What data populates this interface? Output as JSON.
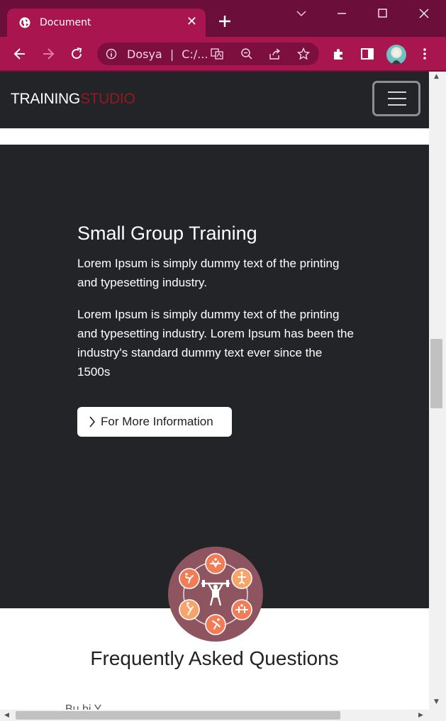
{
  "browser": {
    "tab_title": "Document",
    "tab_close": "✕",
    "new_tab": "+",
    "address_scheme": "Dosya",
    "address_separator": "|",
    "address_path": "C:/...",
    "colors": {
      "frame": "#6b0f3a",
      "tab": "#a8154f",
      "omnibox": "#7d0f3e"
    }
  },
  "navbar": {
    "brand_primary": "TRAINING",
    "brand_accent": "STUDIO",
    "brand_accent_color": "#8f1a22",
    "menu_icon": "hamburger-icon"
  },
  "hero": {
    "title": "Small Group Training",
    "paragraph_1": "Lorem Ipsum is simply dummy text of the printing and typesetting industry.",
    "paragraph_2": "Lorem Ipsum is simply dummy text of the printing and typesetting industry. Lorem Ipsum has been the industry's standard dummy text ever since the 1500s",
    "button_label": "For More Information",
    "button_icon": "chevron-right-icon",
    "background": "#232427"
  },
  "faq": {
    "title": "Frequently Asked Questions",
    "cut_off_text": "Bu bi Y ..."
  }
}
